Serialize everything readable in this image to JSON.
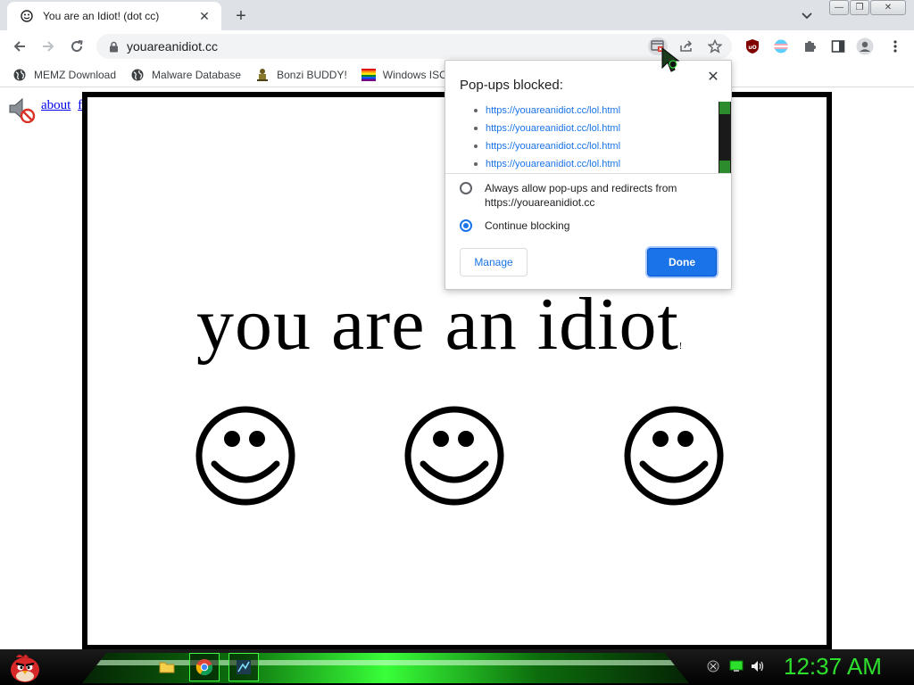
{
  "tab": {
    "title": "You are an Idiot! (dot cc)",
    "close": "✕"
  },
  "new_tab": "+",
  "window_buttons": {
    "minimize": "—",
    "maximize": "❐",
    "close": "✕"
  },
  "omnibox": {
    "url": "youareanidiot.cc"
  },
  "bookmarks": [
    {
      "label": "MEMZ Download",
      "icon": "globe-icon"
    },
    {
      "label": "Malware Database",
      "icon": "globe-icon"
    },
    {
      "label": "Bonzi BUDDY!",
      "icon": "bonzi-icon"
    },
    {
      "label": "Windows ISOs",
      "icon": "windows-flag-icon"
    }
  ],
  "page": {
    "links": [
      "about",
      "flash"
    ],
    "headline": "you are an idiot",
    "headline_mark": "!"
  },
  "popup": {
    "title": "Pop-ups blocked:",
    "blocked_urls": [
      "https://youareanidiot.cc/lol.html",
      "https://youareanidiot.cc/lol.html",
      "https://youareanidiot.cc/lol.html",
      "https://youareanidiot.cc/lol.html"
    ],
    "option_allow": "Always allow pop-ups and redirects from https://youareanidiot.cc",
    "option_block": "Continue blocking",
    "selected": "block",
    "manage_label": "Manage",
    "done_label": "Done"
  },
  "taskbar": {
    "clock": "12:37 AM"
  },
  "colors": {
    "accent": "#1a73e8",
    "taskbar_green": "#2ee02e",
    "link": "#0000ee"
  }
}
